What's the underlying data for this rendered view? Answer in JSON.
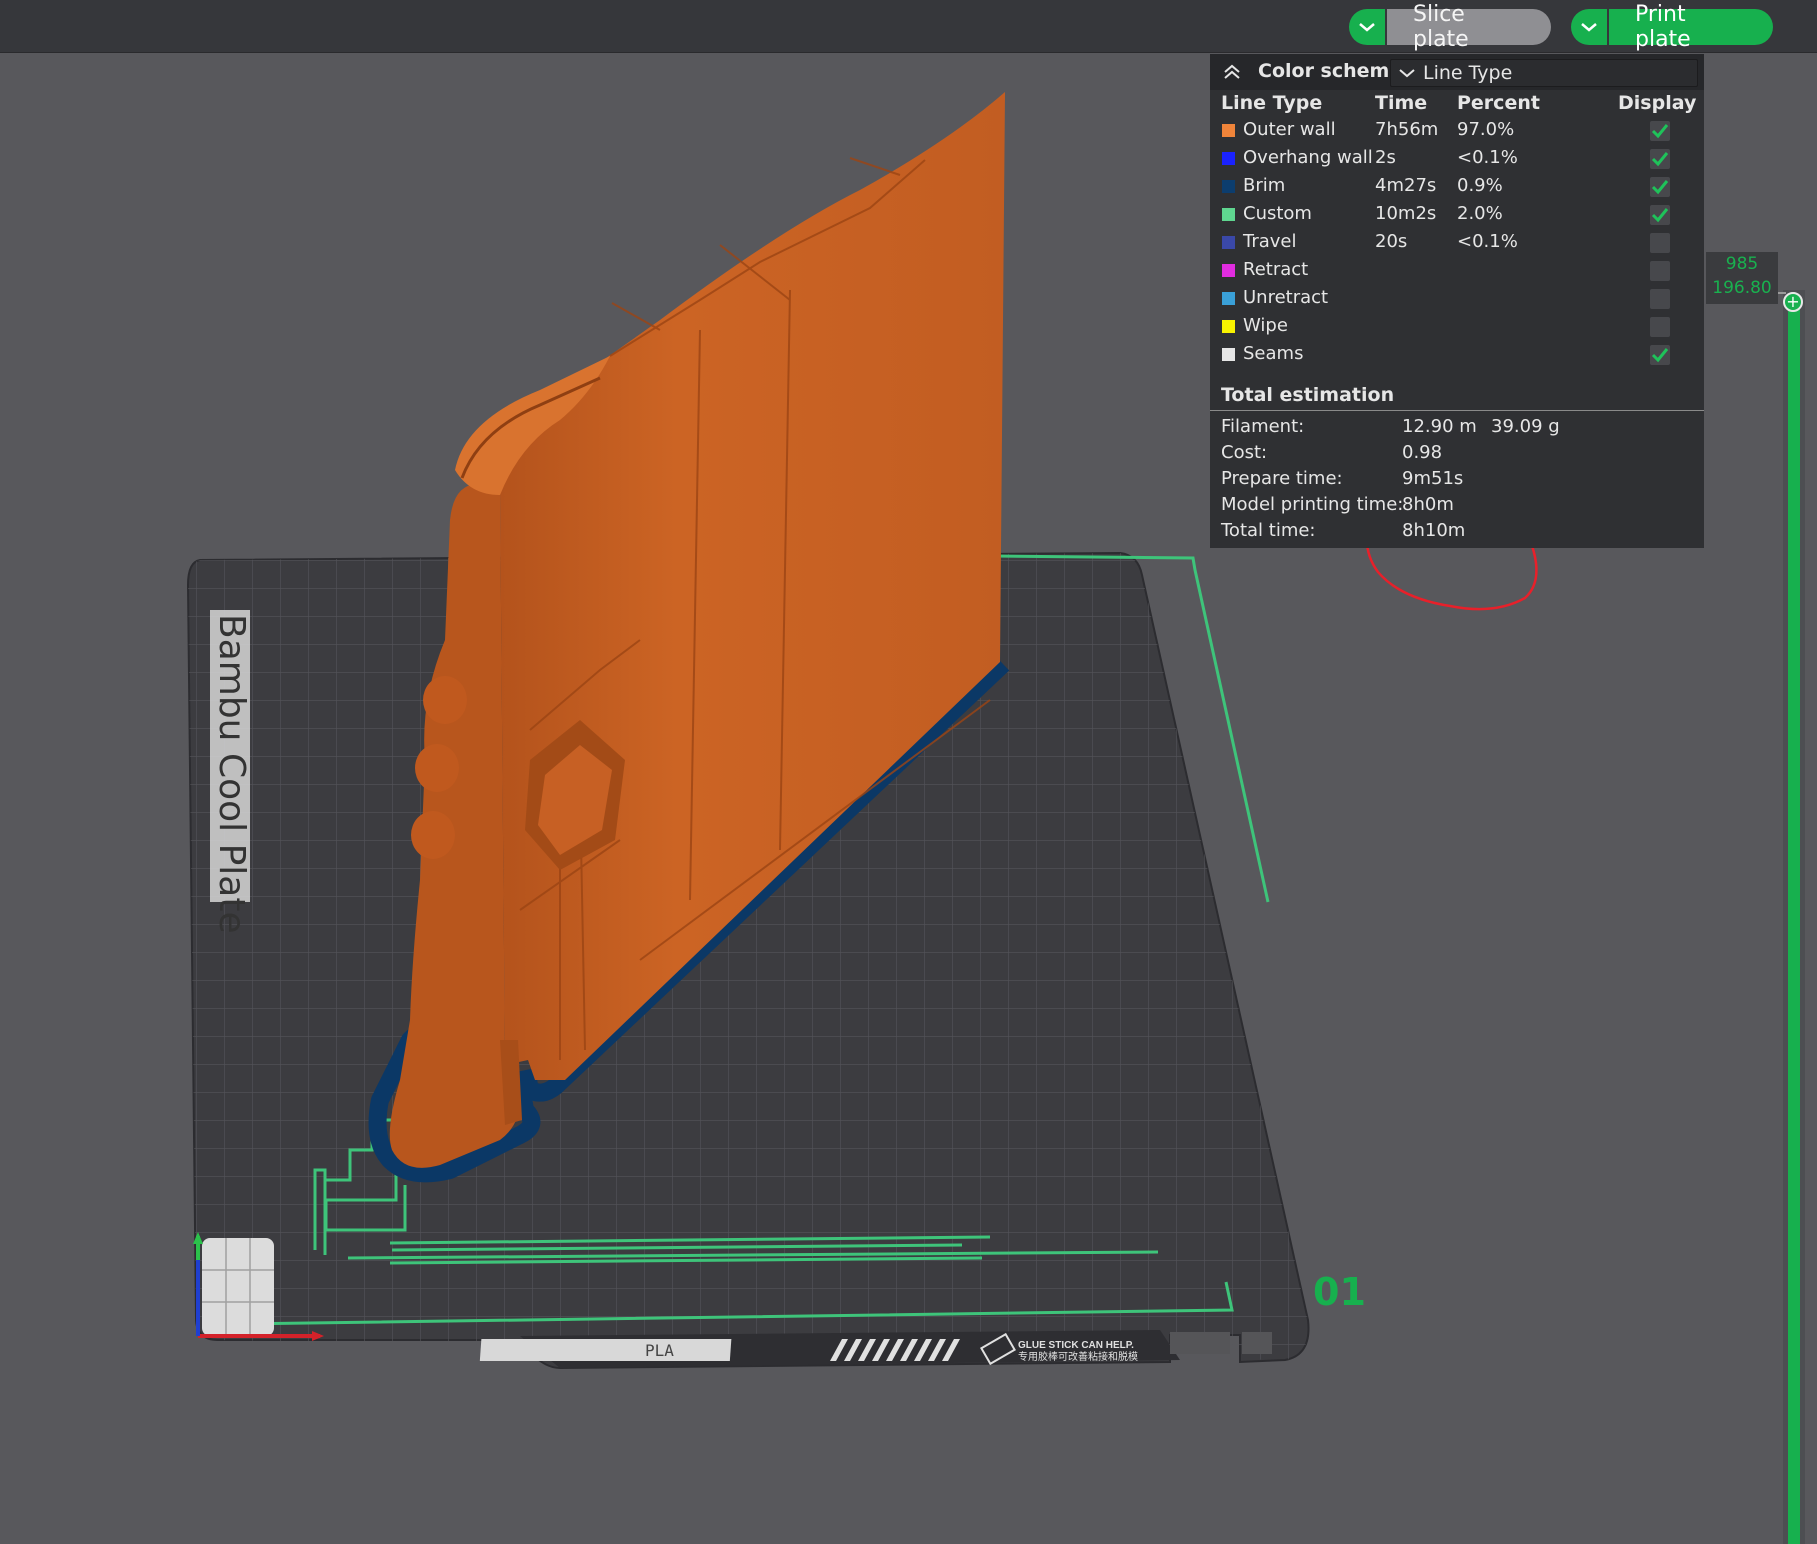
{
  "toolbar": {
    "slice_label": "Slice plate",
    "print_label": "Print plate",
    "accent": "#17b04e"
  },
  "bed": {
    "plate_name": "Bambu Cool Plate",
    "plate_number": "01",
    "filament_tag": "PLA",
    "glue_text_en": "GLUE STICK CAN HELP.",
    "glue_text_cn": "专用胶棒可改善粘接和脱模"
  },
  "legend": {
    "title": "Color scheme",
    "scheme_value": "Line Type",
    "columns": {
      "type": "Line Type",
      "time": "Time",
      "percent": "Percent",
      "display": "Display"
    },
    "rows": [
      {
        "name": "Outer wall",
        "time": "7h56m",
        "percent": "97.0%",
        "color": "#f0843a",
        "checked": true
      },
      {
        "name": "Overhang wall",
        "time": "2s",
        "percent": "<0.1%",
        "color": "#1a22ff",
        "checked": true
      },
      {
        "name": "Brim",
        "time": "4m27s",
        "percent": "0.9%",
        "color": "#0c3d6e",
        "checked": true
      },
      {
        "name": "Custom",
        "time": "10m2s",
        "percent": "2.0%",
        "color": "#5fd690",
        "checked": true
      },
      {
        "name": "Travel",
        "time": "20s",
        "percent": "<0.1%",
        "color": "#3a48a8",
        "checked": false
      },
      {
        "name": "Retract",
        "time": "",
        "percent": "",
        "color": "#e12ce0",
        "checked": false
      },
      {
        "name": "Unretract",
        "time": "",
        "percent": "",
        "color": "#3aa0d8",
        "checked": false
      },
      {
        "name": "Wipe",
        "time": "",
        "percent": "",
        "color": "#f8f200",
        "checked": false
      },
      {
        "name": "Seams",
        "time": "",
        "percent": "",
        "color": "#e6e6e6",
        "checked": true
      }
    ],
    "total": {
      "title": "Total estimation",
      "filament_label": "Filament:",
      "filament_length": "12.90 m",
      "filament_weight": "39.09 g",
      "cost_label": "Cost:",
      "cost_value": "0.98",
      "prepare_label": "Prepare time:",
      "prepare_value": "9m51s",
      "model_label": "Model printing time:",
      "model_value": "8h0m",
      "total_label": "Total time:",
      "total_value": "8h10m"
    }
  },
  "layer_slider": {
    "layer": "985",
    "height": "196.80",
    "handle_glyph": "+"
  },
  "colors": {
    "model": "#c95f22",
    "brim": "#0b3866",
    "bed": "#3a3a3e",
    "custom_lines": "#3ec47a",
    "annotation": "#e8202a"
  }
}
